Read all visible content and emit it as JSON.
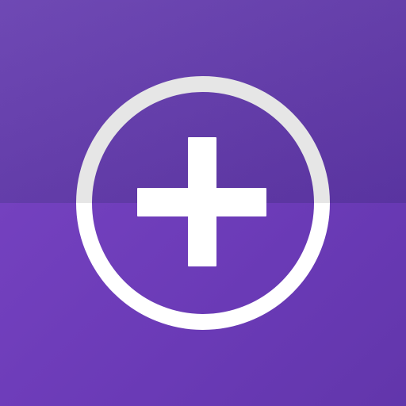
{
  "app_icon": {
    "name": "add-circle-icon",
    "background_top": "#6a43b2",
    "background_bottom": "#7441bf",
    "ring_top_color": "#e6e6e6",
    "ring_bottom_color": "#ffffff",
    "plus_color": "#ffffff"
  }
}
